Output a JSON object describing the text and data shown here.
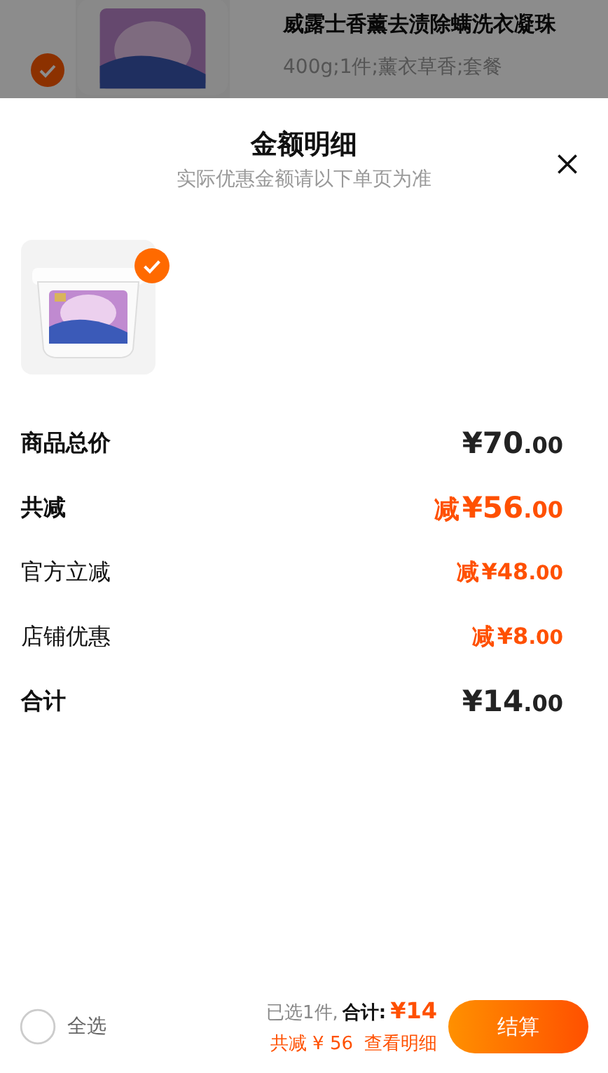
{
  "background_page": {
    "product_title": "威露士香薰去渍除螨洗衣凝珠",
    "product_spec": "400g;1件;薰衣草香;套餐",
    "product_checked": true
  },
  "sheet": {
    "title": "金额明细",
    "subtitle": "实际优惠金额请以下单页为准",
    "item_checked": true,
    "rows": [
      {
        "kind": "main",
        "label": "商品总价",
        "prefix": "",
        "amount": "¥70.00"
      },
      {
        "kind": "discount",
        "label": "共减",
        "prefix": "减",
        "amount": "¥56.00"
      },
      {
        "kind": "sub-discount",
        "label": "官方立减",
        "prefix": "减",
        "amount": "¥48.00"
      },
      {
        "kind": "sub-discount",
        "label": "店铺优惠",
        "prefix": "减",
        "amount": "¥8.00"
      },
      {
        "kind": "main",
        "label": "合计",
        "prefix": "",
        "amount": "¥14.00"
      }
    ]
  },
  "bottom_bar": {
    "select_all": {
      "label": "全选",
      "checked": false
    },
    "selected_count": "已选1件,",
    "total_label": "合计:",
    "total_value": "¥14",
    "savings": "共减 ¥ 56",
    "details_link": "查看明细",
    "checkout": "结算"
  }
}
